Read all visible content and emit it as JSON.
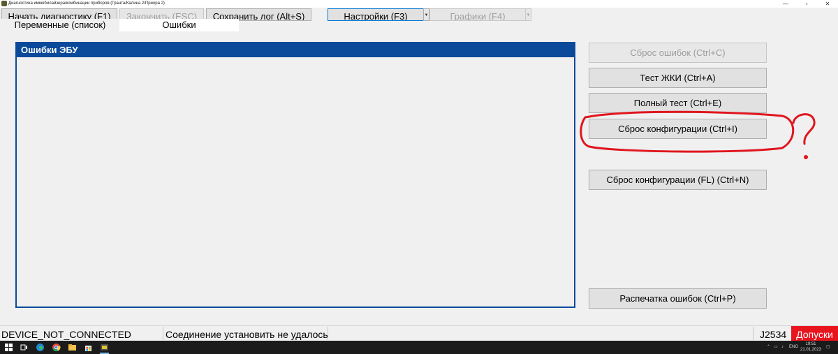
{
  "window": {
    "title": "Диагностика иммобилайзера/комбинации приборов (Гранта/Калина 2/Приора 2)",
    "controls": {
      "minimize": "—",
      "maximize": "▫",
      "close": "✕"
    }
  },
  "toolbar": {
    "start_label": "Начать диагностику (F1)",
    "stop_label": "Закончить (ESC)",
    "save_log_label": "Сохранить лог (Alt+S)",
    "settings_label": "Настройки (F3)",
    "charts_label": "Графики (F4)",
    "dropdown_arrow": "▼"
  },
  "tabs": [
    {
      "label": "Переменные (список)",
      "active": false
    },
    {
      "label": "Ошибки",
      "active": true
    }
  ],
  "errors_panel": {
    "title": "Ошибки ЭБУ",
    "items": []
  },
  "actions": {
    "reset_errors": "Сброс ошибок (Ctrl+C)",
    "lcd_test": "Тест ЖКИ (Ctrl+A)",
    "full_test": "Полный тест (Ctrl+E)",
    "reset_config": "Сброс конфигурации (Ctrl+I)",
    "reset_config_fl": "Сброс конфигурации (FL) (Ctrl+N)",
    "print_errors": "Распечатка ошибок (Ctrl+P)"
  },
  "annotation": {
    "mark": "?",
    "color": "#e0161e"
  },
  "status": {
    "device": "DEVICE_NOT_CONNECTED",
    "message": "Соединение установить не удалось",
    "adapter": "J2534",
    "badge": "Допуски",
    "badge_color": "#e8141e"
  },
  "taskbar": {
    "icons": [
      "windows-start-icon",
      "task-view-icon",
      "edge-icon",
      "chrome-icon",
      "file-explorer-icon",
      "store-icon",
      "app-icon"
    ],
    "lang": "ENG",
    "time": "19:51",
    "date": "21.01.2023"
  }
}
